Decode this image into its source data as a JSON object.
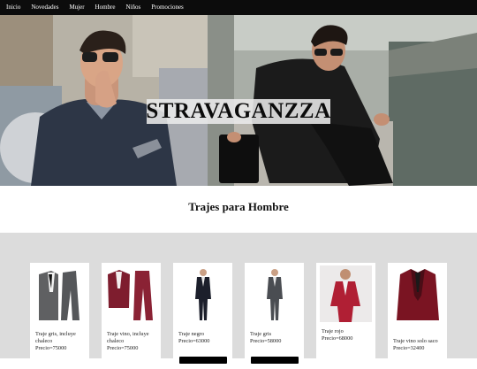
{
  "nav": {
    "items": [
      "Inicio",
      "Novedades",
      "Mujer",
      "Hombre",
      "Niños",
      "Promociones"
    ]
  },
  "hero": {
    "brand": "STRAVAGANZZA"
  },
  "section": {
    "title": "Trajes para Hombre"
  },
  "products": [
    {
      "name": "Traje gris, incluye chaleco",
      "price": "Precio=75000",
      "icon": "three-piece-grey-suit-icon",
      "color": "#5f6062"
    },
    {
      "name": "Traje vino, incluye chaleco",
      "price": "Precio=75000",
      "icon": "three-piece-wine-suit-icon",
      "color": "#7e1d2e"
    },
    {
      "name": "Traje negro",
      "price": "Precio=63000",
      "icon": "black-suit-model-icon",
      "color": "#1c1f2b"
    },
    {
      "name": "Traje gris",
      "price": "Precio=58000",
      "icon": "grey-suit-model-icon",
      "color": "#4a4d52"
    },
    {
      "name": "Traje rojo",
      "price": "Precio=68000",
      "icon": "red-suit-model-icon",
      "color": "#b01f34"
    },
    {
      "name": "Traje vino solo saco",
      "price": "Precio=32400",
      "icon": "wine-blazer-icon",
      "color": "#7a1422"
    }
  ]
}
